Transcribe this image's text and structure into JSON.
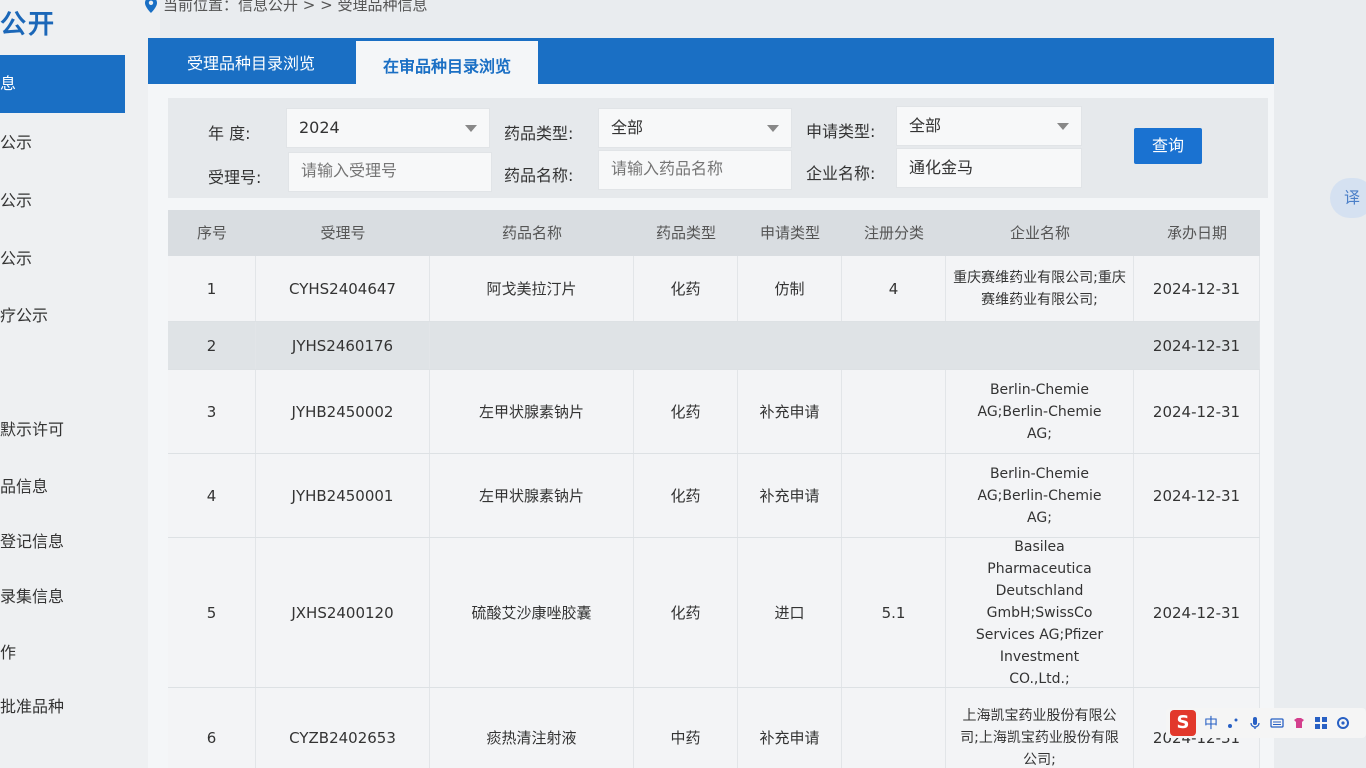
{
  "sidebar": {
    "brand": "公开",
    "items": [
      {
        "label": "息",
        "active": true
      },
      {
        "label": "公示"
      },
      {
        "label": "公示"
      },
      {
        "label": "公示"
      },
      {
        "label": "疗公示"
      },
      {
        "label": "默示许可"
      },
      {
        "label": "品信息"
      },
      {
        "label": "登记信息"
      },
      {
        "label": "录集信息"
      },
      {
        "label": "作"
      },
      {
        "label": "批准品种"
      }
    ]
  },
  "breadcrumb": {
    "text": "当前位置：信息公开 > > 受理品种信息"
  },
  "tabs": [
    {
      "label": "受理品种目录浏览"
    },
    {
      "label": "在审品种目录浏览"
    }
  ],
  "filters": {
    "year_label": "年    度:",
    "year_value": "2024",
    "drug_type_label": "药品类型:",
    "drug_type_value": "全部",
    "apply_type_label": "申请类型:",
    "apply_type_value": "全部",
    "accept_no_label": "受理号:",
    "accept_no_placeholder": "请输入受理号",
    "drug_name_label": "药品名称:",
    "drug_name_placeholder": "请输入药品名称",
    "company_label": "企业名称:",
    "company_value": "通化金马",
    "query_button": "查询"
  },
  "table": {
    "headers": [
      "序号",
      "受理号",
      "药品名称",
      "药品类型",
      "申请类型",
      "注册分类",
      "企业名称",
      "承办日期"
    ],
    "rows": [
      {
        "no": "1",
        "accept_no": "CYHS2404647",
        "drug_name": "阿戈美拉汀片",
        "drug_type": "化药",
        "apply_type": "仿制",
        "reg_class": "4",
        "company": "重庆赛维药业有限公司;重庆赛维药业有限公司;",
        "date": "2024-12-31"
      },
      {
        "no": "2",
        "accept_no": "JYHS2460176",
        "drug_name": "",
        "drug_type": "",
        "apply_type": "",
        "reg_class": "",
        "company": "",
        "date": "2024-12-31"
      },
      {
        "no": "3",
        "accept_no": "JYHB2450002",
        "drug_name": "左甲状腺素钠片",
        "drug_type": "化药",
        "apply_type": "补充申请",
        "reg_class": "",
        "company": "Berlin-Chemie AG;Berlin-Chemie AG;",
        "date": "2024-12-31"
      },
      {
        "no": "4",
        "accept_no": "JYHB2450001",
        "drug_name": "左甲状腺素钠片",
        "drug_type": "化药",
        "apply_type": "补充申请",
        "reg_class": "",
        "company": "Berlin-Chemie AG;Berlin-Chemie AG;",
        "date": "2024-12-31"
      },
      {
        "no": "5",
        "accept_no": "JXHS2400120",
        "drug_name": "硫酸艾沙康唑胶囊",
        "drug_type": "化药",
        "apply_type": "进口",
        "reg_class": "5.1",
        "company": "Basilea Pharmaceutica Deutschland GmbH;SwissCo Services AG;Pfizer Investment CO.,Ltd.;",
        "date": "2024-12-31"
      },
      {
        "no": "6",
        "accept_no": "CYZB2402653",
        "drug_name": "痰热清注射液",
        "drug_type": "中药",
        "apply_type": "补充申请",
        "reg_class": "",
        "company": "上海凯宝药业股份有限公司;上海凯宝药业股份有限公司;",
        "date": "2024-12-31"
      }
    ]
  },
  "overlay": {
    "translate_label": "译",
    "ime_logo": "S",
    "ime_lang": "中"
  },
  "colors": {
    "primary": "#1a6fc4",
    "button": "#1a72d1"
  }
}
